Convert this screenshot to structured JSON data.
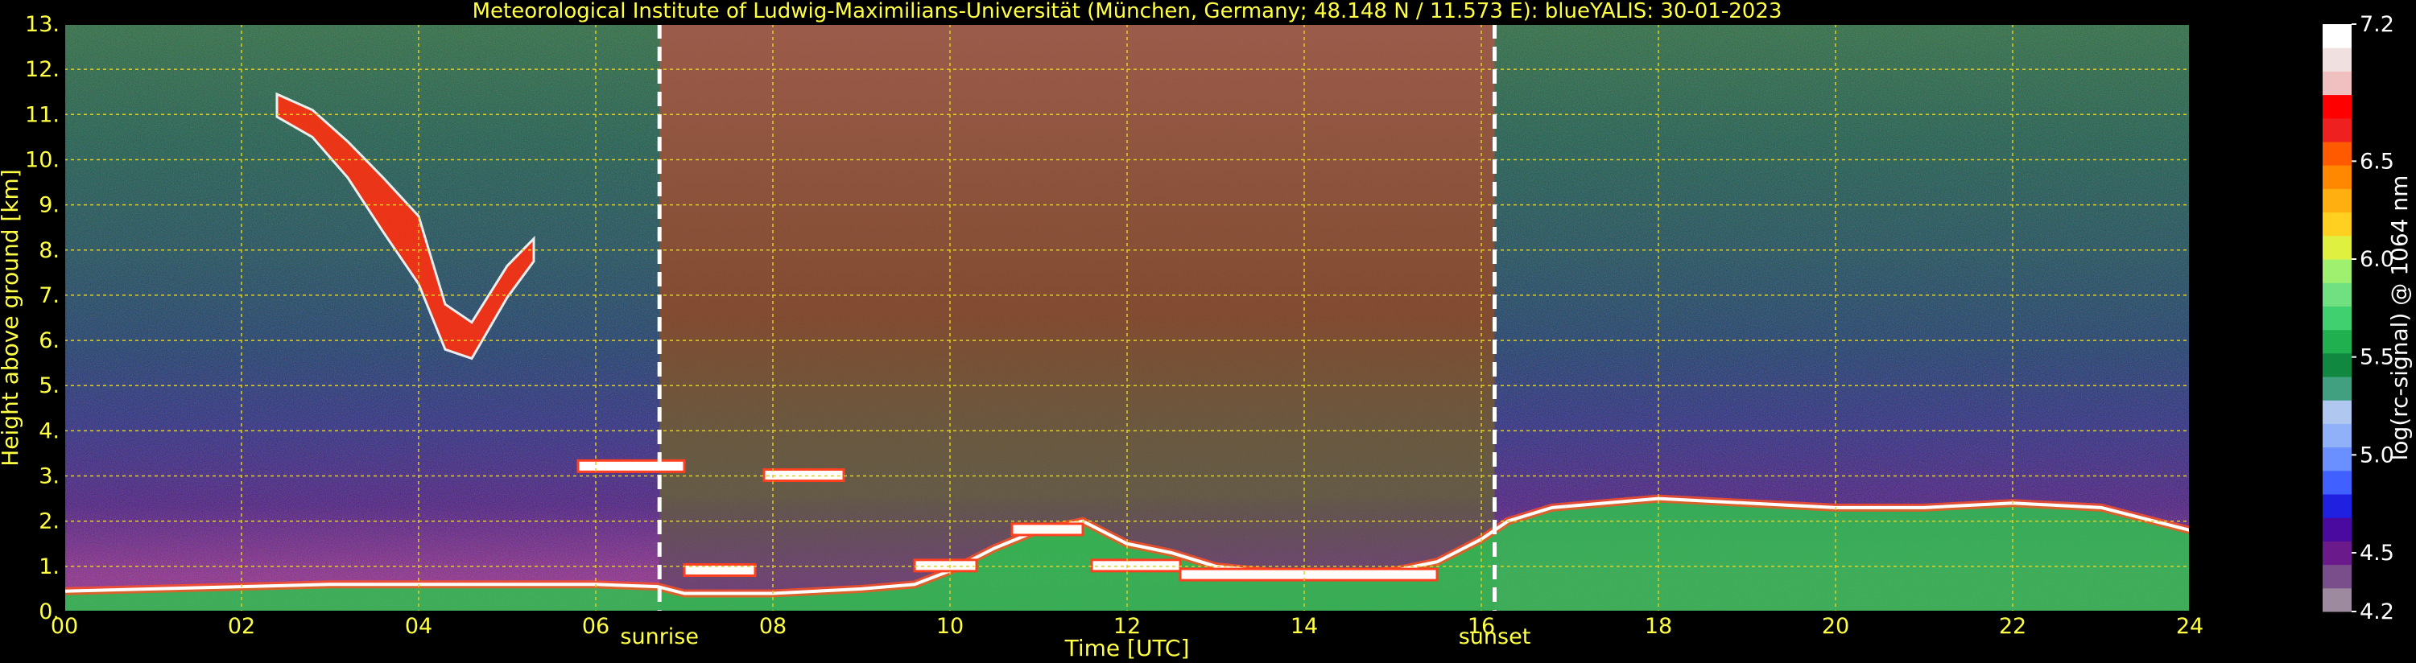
{
  "chart_data": {
    "type": "heatmap",
    "title": "Meteorological Institute of Ludwig-Maximilians-Universität (München, Germany; 48.148 N / 11.573 E):    blueYALIS: 30-01-2023",
    "xlabel": "Time [UTC]",
    "ylabel": "Height above ground [km]",
    "xlim": [
      0,
      24
    ],
    "ylim": [
      0,
      13
    ],
    "grid": true,
    "x_ticks": [
      {
        "value": 0,
        "label": "00"
      },
      {
        "value": 2,
        "label": "02"
      },
      {
        "value": 4,
        "label": "04"
      },
      {
        "value": 6,
        "label": "06"
      },
      {
        "value": 8,
        "label": "08"
      },
      {
        "value": 10,
        "label": "10"
      },
      {
        "value": 12,
        "label": "12"
      },
      {
        "value": 14,
        "label": "14"
      },
      {
        "value": 16,
        "label": "16"
      },
      {
        "value": 18,
        "label": "18"
      },
      {
        "value": 20,
        "label": "20"
      },
      {
        "value": 22,
        "label": "22"
      },
      {
        "value": 24,
        "label": "24"
      }
    ],
    "y_ticks": [
      {
        "value": 0,
        "label": "0."
      },
      {
        "value": 1,
        "label": "1."
      },
      {
        "value": 2,
        "label": "2."
      },
      {
        "value": 3,
        "label": "3."
      },
      {
        "value": 4,
        "label": "4."
      },
      {
        "value": 5,
        "label": "5."
      },
      {
        "value": 6,
        "label": "6."
      },
      {
        "value": 7,
        "label": "7."
      },
      {
        "value": 8,
        "label": "8."
      },
      {
        "value": 9,
        "label": "9."
      },
      {
        "value": 10,
        "label": "10."
      },
      {
        "value": 11,
        "label": "11."
      },
      {
        "value": 12,
        "label": "12."
      },
      {
        "value": 13,
        "label": "13."
      }
    ],
    "markers": [
      {
        "x": 6.72,
        "label": "sunrise"
      },
      {
        "x": 16.15,
        "label": "sunset"
      }
    ],
    "colorbar": {
      "label": "log(rc-signal) @ 1064 nm",
      "range": [
        4.2,
        7.2
      ],
      "ticks": [
        {
          "value": 4.2,
          "label": "4.2"
        },
        {
          "value": 4.5,
          "label": "4.5"
        },
        {
          "value": 5.0,
          "label": "5.0"
        },
        {
          "value": 5.5,
          "label": "5.5"
        },
        {
          "value": 6.0,
          "label": "6.0"
        },
        {
          "value": 6.5,
          "label": "6.5"
        },
        {
          "value": 7.2,
          "label": "7.2"
        }
      ],
      "colors": [
        "#9e8a9e",
        "#7a4e8a",
        "#6a1a8a",
        "#4a0aa0",
        "#2020e0",
        "#4060ff",
        "#6a90ff",
        "#90b0f8",
        "#b0c8f0",
        "#40a080",
        "#108840",
        "#20b050",
        "#40d070",
        "#70e080",
        "#a0f070",
        "#e0f040",
        "#ffd020",
        "#ffb010",
        "#ff8800",
        "#ff5a00",
        "#ee2020",
        "#ff0000",
        "#f0c0c0",
        "#f0e0e0",
        "#ffffff"
      ]
    },
    "features": {
      "boundary_layer": {
        "x": [
          0,
          1,
          2,
          3,
          4,
          5,
          6,
          6.7,
          7,
          8,
          9,
          9.6,
          10,
          10.5,
          11,
          11.5,
          12,
          12.5,
          13,
          14,
          15,
          15.5,
          16,
          16.3,
          16.8,
          18,
          19,
          20,
          21,
          22,
          23,
          24
        ],
        "top_km": [
          0.45,
          0.5,
          0.55,
          0.6,
          0.6,
          0.6,
          0.6,
          0.55,
          0.4,
          0.4,
          0.5,
          0.6,
          0.9,
          1.4,
          1.8,
          2.0,
          1.5,
          1.3,
          1.0,
          0.8,
          0.9,
          1.1,
          1.6,
          2.0,
          2.3,
          2.5,
          2.4,
          2.3,
          2.3,
          2.4,
          2.3,
          1.8
        ]
      },
      "cirrus": {
        "x": [
          2.4,
          2.8,
          3.2,
          3.6,
          4.0,
          4.3,
          4.6,
          5.0,
          5.3
        ],
        "center_km": [
          11.2,
          10.8,
          10.0,
          9.0,
          8.0,
          6.3,
          6.0,
          7.3,
          8.0
        ],
        "thickness_km": [
          0.5,
          0.6,
          0.8,
          1.2,
          1.5,
          1.0,
          0.8,
          0.7,
          0.5
        ]
      },
      "cloud_layers": [
        {
          "x": [
            5.8,
            7.0
          ],
          "height_km": 3.2
        },
        {
          "x": [
            7.9,
            8.8
          ],
          "height_km": 3.0
        },
        {
          "x": [
            7.0,
            7.8
          ],
          "height_km": 0.9
        },
        {
          "x": [
            9.6,
            10.3
          ],
          "height_km": 1.0
        },
        {
          "x": [
            10.7,
            11.5
          ],
          "height_km": 1.8
        },
        {
          "x": [
            11.6,
            12.6
          ],
          "height_km": 1.0
        },
        {
          "x": [
            12.6,
            15.5
          ],
          "height_km": 0.8
        }
      ],
      "daylight_noise": {
        "x": [
          6.72,
          16.15
        ]
      }
    }
  }
}
